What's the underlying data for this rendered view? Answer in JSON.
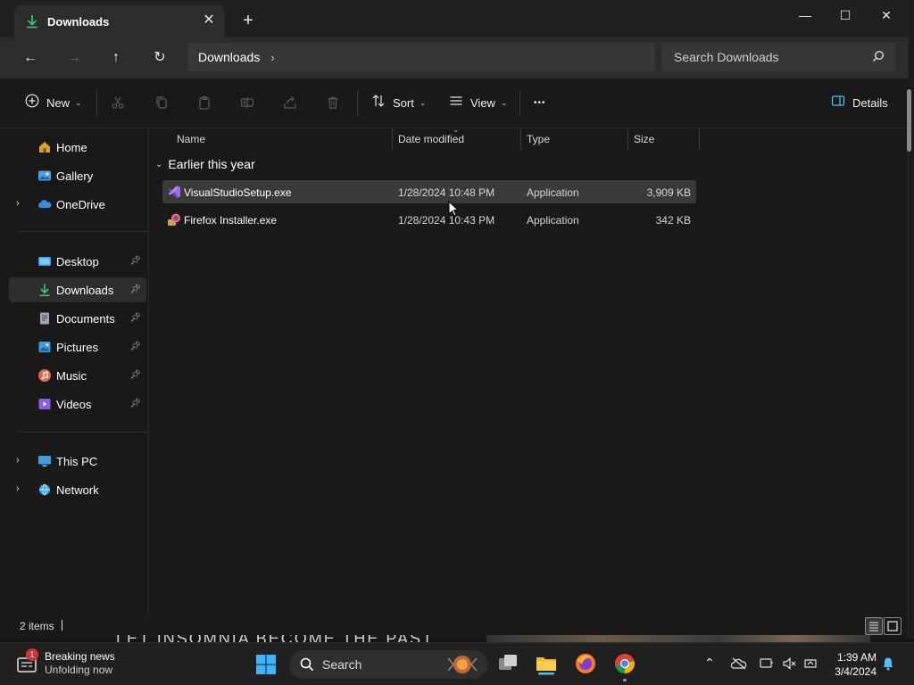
{
  "window": {
    "tab_title": "Downloads",
    "tab_icon": "download-arrow-icon",
    "tab_close": "✕",
    "new_tab": "+",
    "minimize": "—",
    "maximize": "☐",
    "close": "✕"
  },
  "nav": {
    "back": "←",
    "forward": "→",
    "up": "↑",
    "refresh": "↻",
    "breadcrumb": [
      "Downloads"
    ],
    "breadcrumb_sep": "›",
    "search_placeholder": "Search Downloads"
  },
  "toolbar": {
    "new_label": "New",
    "sort_label": "Sort",
    "view_label": "View",
    "more_label": "•••",
    "details_label": "Details"
  },
  "sidebar": {
    "items": [
      {
        "label": "Home",
        "icon": "home-icon",
        "color": "#e0a030"
      },
      {
        "label": "Gallery",
        "icon": "gallery-icon",
        "color": "#4aa3e8"
      },
      {
        "label": "OneDrive",
        "icon": "onedrive-icon",
        "color": "#2f8fe0"
      },
      {
        "label": "Desktop",
        "icon": "desktop-icon",
        "color": "#3ba0e6"
      },
      {
        "label": "Downloads",
        "icon": "downloads-icon",
        "color": "#3fbf7a"
      },
      {
        "label": "Documents",
        "icon": "documents-icon",
        "color": "#9aa7b8"
      },
      {
        "label": "Pictures",
        "icon": "pictures-icon",
        "color": "#3b9de0"
      },
      {
        "label": "Music",
        "icon": "music-icon",
        "color": "#e06a4a"
      },
      {
        "label": "Videos",
        "icon": "videos-icon",
        "color": "#8a5ee0"
      },
      {
        "label": "This PC",
        "icon": "this-pc-icon",
        "color": "#3ba0e6"
      },
      {
        "label": "Network",
        "icon": "network-icon",
        "color": "#3ba0e6"
      }
    ]
  },
  "columns": [
    "Name",
    "Date modified",
    "Type",
    "Size"
  ],
  "group": {
    "title": "Earlier this year"
  },
  "files": [
    {
      "name": "VisualStudioSetup.exe",
      "date": "1/28/2024 10:48 PM",
      "type": "Application",
      "size": "3,909 KB",
      "icon": "visual-studio-icon"
    },
    {
      "name": "Firefox Installer.exe",
      "date": "1/28/2024 10:43 PM",
      "type": "Application",
      "size": "342 KB",
      "icon": "firefox-installer-icon"
    }
  ],
  "status": {
    "item_count": "2 items"
  },
  "background": {
    "banner_text": "LET INSOMNIA BECOME THE PAST"
  },
  "taskbar": {
    "news_badge": "1",
    "news_title": "Breaking news",
    "news_subtitle": "Unfolding now",
    "search_label": "Search",
    "time": "1:39 AM",
    "date": "3/4/2024"
  },
  "colors": {
    "accent": "#4cc2ff",
    "selected_row": "#3a3a3a",
    "badge": "#d13438"
  }
}
